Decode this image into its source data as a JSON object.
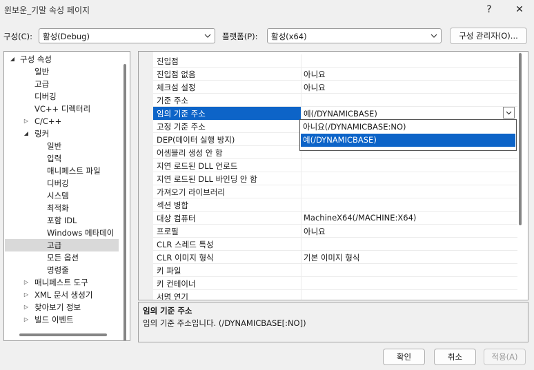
{
  "window": {
    "title": "윈보운_기말 속성 페이지",
    "help_label": "?",
    "close_label": "✕"
  },
  "config": {
    "configuration_label": "구성(C):",
    "configuration_value": "활성(Debug)",
    "platform_label": "플랫폼(P):",
    "platform_value": "활성(x64)",
    "manager_button": "구성 관리자(O)..."
  },
  "tree": {
    "root": "구성 속성",
    "items": [
      {
        "label": "일반"
      },
      {
        "label": "고급"
      },
      {
        "label": "디버깅"
      },
      {
        "label": "VC++ 디렉터리"
      },
      {
        "label": "C/C++"
      },
      {
        "label": "링커"
      },
      {
        "label": "일반"
      },
      {
        "label": "입력"
      },
      {
        "label": "매니페스트 파일"
      },
      {
        "label": "디버깅"
      },
      {
        "label": "시스템"
      },
      {
        "label": "최적화"
      },
      {
        "label": "포함 IDL"
      },
      {
        "label": "Windows 메타데이"
      },
      {
        "label": "고급"
      },
      {
        "label": "모든 옵션"
      },
      {
        "label": "명령줄"
      },
      {
        "label": "매니페스트 도구"
      },
      {
        "label": "XML 문서 생성기"
      },
      {
        "label": "찾아보기 정보"
      },
      {
        "label": "빌드 이벤트"
      }
    ]
  },
  "grid": {
    "rows": [
      {
        "name": "진입점",
        "value": ""
      },
      {
        "name": "진입점 없음",
        "value": "아니요"
      },
      {
        "name": "체크섬 설정",
        "value": "아니요"
      },
      {
        "name": "기준 주소",
        "value": ""
      },
      {
        "name": "임의 기준 주소",
        "value": "예(/DYNAMICBASE)"
      },
      {
        "name": "고정 기준 주소",
        "value": ""
      },
      {
        "name": "DEP(데이터 실행 방지)",
        "value": ""
      },
      {
        "name": "어셈블리 생성 안 함",
        "value": ""
      },
      {
        "name": "지연 로드된 DLL 언로드",
        "value": ""
      },
      {
        "name": "지연 로드된 DLL 바인딩 안 함",
        "value": ""
      },
      {
        "name": "가져오기 라이브러리",
        "value": ""
      },
      {
        "name": "섹션 병합",
        "value": ""
      },
      {
        "name": "대상 컴퓨터",
        "value": "MachineX64(/MACHINE:X64)"
      },
      {
        "name": "프로필",
        "value": "아니요"
      },
      {
        "name": "CLR 스레드 특성",
        "value": ""
      },
      {
        "name": "CLR 이미지 형식",
        "value": "기본 이미지 형식"
      },
      {
        "name": "키 파일",
        "value": ""
      },
      {
        "name": "키 컨테이너",
        "value": ""
      },
      {
        "name": "서명 연기",
        "value": ""
      }
    ],
    "dropdown_options": [
      "아니요(/DYNAMICBASE:NO)",
      "예(/DYNAMICBASE)"
    ]
  },
  "description": {
    "title": "임의 기준 주소",
    "text": "임의 기준 주소입니다. (/DYNAMICBASE[:NO])"
  },
  "footer": {
    "ok": "확인",
    "cancel": "취소",
    "apply": "적용(A)"
  },
  "colors": {
    "selection": "#0d64c8",
    "tree_selection": "#d9d9d9"
  }
}
